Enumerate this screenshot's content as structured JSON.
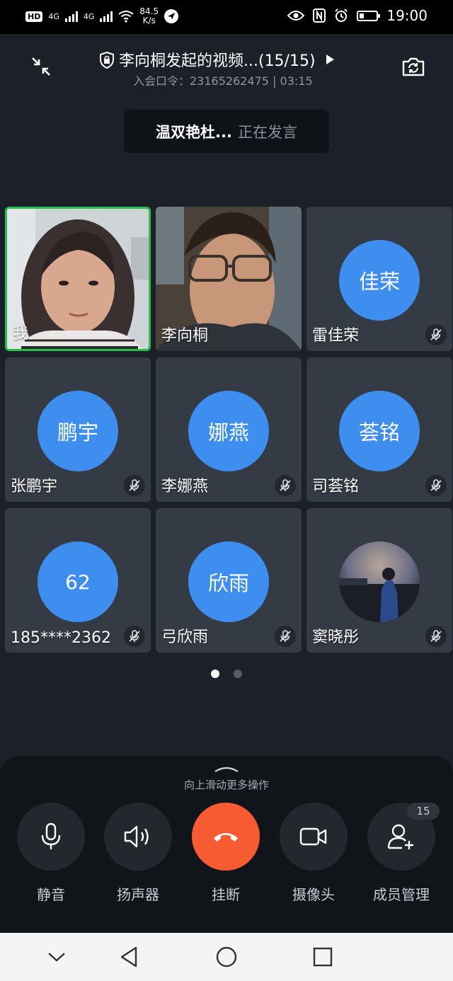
{
  "status_bar": {
    "hd": "HD",
    "signal_1": "4G",
    "signal_2": "4G",
    "speed_value": "84.5",
    "speed_unit": "K/s",
    "time": "19:00",
    "icons": [
      "hd-icon",
      "signal-icon",
      "wifi-icon",
      "location-arrow-icon",
      "eye-icon",
      "nfc-icon",
      "alarm-icon",
      "battery-icon"
    ]
  },
  "header": {
    "title": "李向桐发起的视频...(15/15)",
    "subtitle": "入会口令：23165262475 | 03:15",
    "speaking_name": "温双艳杜...",
    "speaking_status": "正在发言"
  },
  "participants": [
    {
      "name": "我",
      "type": "video",
      "active": true,
      "muted": false
    },
    {
      "name": "李向桐",
      "type": "video",
      "active": false,
      "muted": false
    },
    {
      "name": "雷佳荣",
      "avatar": "佳荣",
      "muted": true
    },
    {
      "name": "张鹏宇",
      "avatar": "鹏宇",
      "muted": true
    },
    {
      "name": "李娜燕",
      "avatar": "娜燕",
      "muted": true
    },
    {
      "name": "司荟铭",
      "avatar": "荟铭",
      "muted": true
    },
    {
      "name": "185****2362",
      "avatar": "62",
      "muted": true
    },
    {
      "name": "弓欣雨",
      "avatar": "欣雨",
      "muted": true
    },
    {
      "name": "窦晓彤",
      "avatar": "photo",
      "muted": true
    }
  ],
  "pagination": {
    "pages": 2,
    "current": 1
  },
  "controls": {
    "hint": "向上滑动更多操作",
    "mute": "静音",
    "speaker": "扬声器",
    "hangup": "挂断",
    "camera": "摄像头",
    "members": "成员管理",
    "member_count": "15"
  },
  "colors": {
    "accent": "#3e8ef0",
    "hangup": "#f75b32",
    "active_border": "#27c04a"
  }
}
